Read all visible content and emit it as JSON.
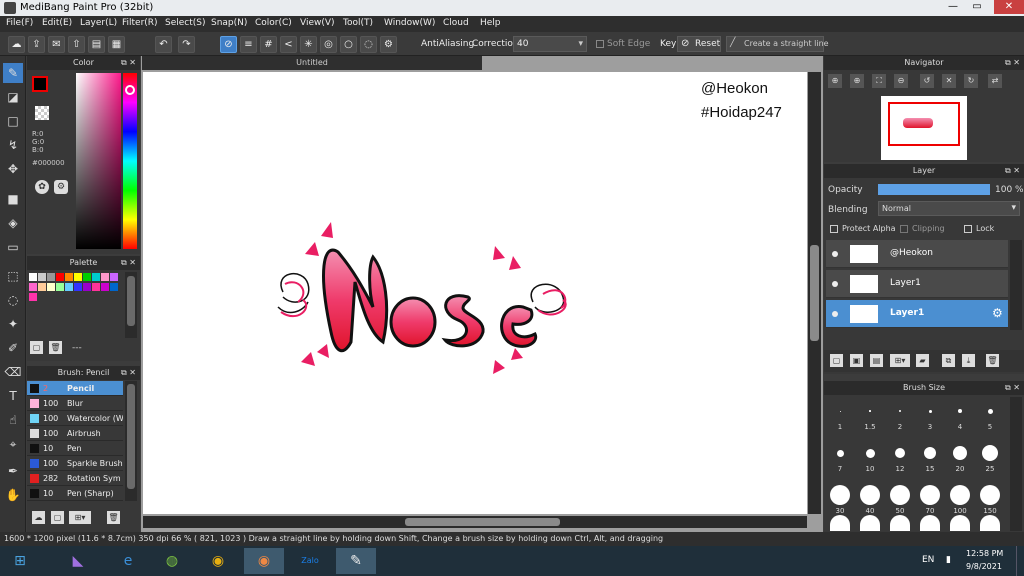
{
  "window": {
    "title": "MediBang Paint Pro (32bit)",
    "min": "—",
    "max": "▭",
    "close": "✕"
  },
  "menu": [
    "File(F)",
    "Edit(E)",
    "Layer(L)",
    "Filter(R)",
    "Select(S)",
    "Snap(N)",
    "Color(C)",
    "View(V)",
    "Tool(T)",
    "Window(W)",
    "Cloud",
    "Help"
  ],
  "toolbar": {
    "antialiasing": "AntiAliasing",
    "correction_label": "Correction",
    "correction_value": "40",
    "soft_edge": "Soft Edge",
    "key": "Key",
    "reset": "Reset",
    "straight_line": "Create a straight line"
  },
  "color_panel": {
    "title": "Color",
    "r": "R:0",
    "g": "G:0",
    "b": "B:0",
    "hex": "#000000"
  },
  "palette_panel": {
    "title": "Palette",
    "entry": "---"
  },
  "brush_panel": {
    "title": "Brush: Pencil",
    "items": [
      {
        "size": "2",
        "name": "Pencil",
        "color": "#111111"
      },
      {
        "size": "100",
        "name": "Blur",
        "color": "#ffb3d9"
      },
      {
        "size": "100",
        "name": "Watercolor (W",
        "color": "#6fd3f5"
      },
      {
        "size": "100",
        "name": "Airbrush",
        "color": "#dddddd"
      },
      {
        "size": "10",
        "name": "Pen",
        "color": "#111111"
      },
      {
        "size": "100",
        "name": "Sparkle Brush",
        "color": "#2b5ad8"
      },
      {
        "size": "282",
        "name": "Rotation Sym",
        "color": "#e02020"
      },
      {
        "size": "10",
        "name": "Pen (Sharp)",
        "color": "#111111"
      }
    ]
  },
  "canvas": {
    "tab": "Untitled",
    "watermark1": "@Heokon",
    "watermark2": "#Hoidap247"
  },
  "navigator": {
    "title": "Navigator"
  },
  "layer_panel": {
    "title": "Layer",
    "opacity_label": "Opacity",
    "opacity_value": "100 %",
    "opacity_fraction": 1.0,
    "blending_label": "Blending",
    "blending_value": "Normal",
    "protect_alpha": "Protect Alpha",
    "clipping": "Clipping",
    "lock": "Lock",
    "layers": [
      {
        "name": "@Heokon",
        "selected": false
      },
      {
        "name": "Layer1",
        "selected": false
      },
      {
        "name": "Layer1",
        "selected": true
      }
    ]
  },
  "brush_size_panel": {
    "title": "Brush Size",
    "sizes": [
      "1",
      "1.5",
      "2",
      "3",
      "4",
      "5",
      "7",
      "10",
      "12",
      "15",
      "20",
      "25",
      "30",
      "40",
      "50",
      "70",
      "100",
      "150"
    ]
  },
  "status": {
    "text": "1600 * 1200 pixel  (11.6 * 8.7cm)  350 dpi  66 %  ( 821, 1023 )  Draw a straight line by holding down Shift, Change a brush size by holding down Ctrl, Alt, and dragging"
  },
  "taskbar": {
    "lang": "EN",
    "time": "12:58 PM",
    "date": "9/8/2021",
    "zalo": "Zalo"
  },
  "colors": {
    "accent": "#3f7fc7",
    "art_pink": "#f06292",
    "art_red": "#e01e2f"
  }
}
